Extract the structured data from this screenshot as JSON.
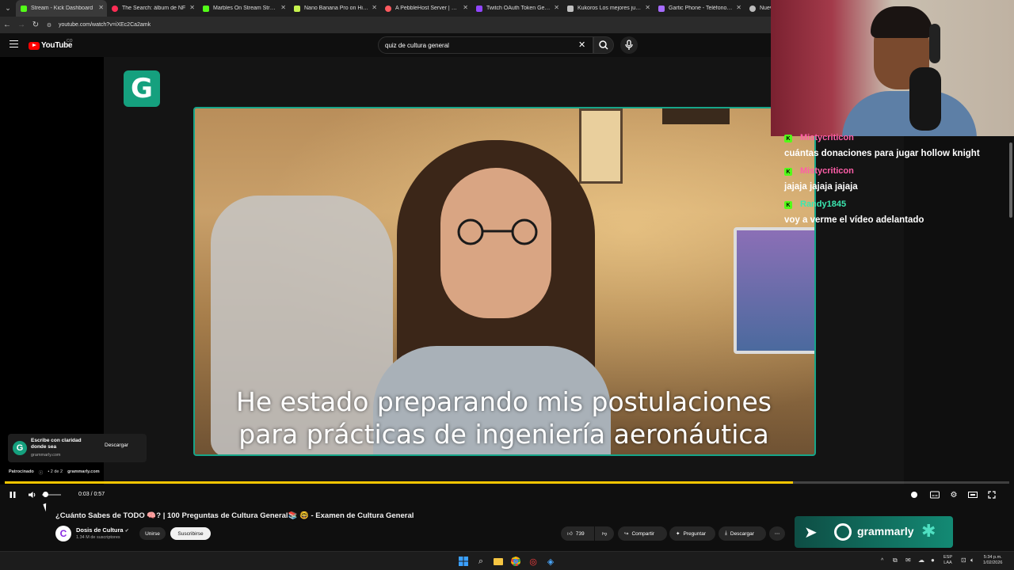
{
  "browser": {
    "tabs": [
      {
        "label": "Stream - Kick Dashboard",
        "color": "#53fc18"
      },
      {
        "label": "The Search: álbum de NF",
        "color": "#ff2d55"
      },
      {
        "label": "Marbles On Stream Streaming",
        "color": "#53fc18"
      },
      {
        "label": "Nano Banana Pro on Higgsfield",
        "color": "#c6f24e"
      },
      {
        "label": "A PebbleHost Server | Console",
        "color": "#ff5a5f"
      },
      {
        "label": "Twitch OAuth Token Generator",
        "color": "#9146ff"
      },
      {
        "label": "Kukoros Los mejores juegos in",
        "color": "#c0c0c0"
      },
      {
        "label": "Gartic Phone - Teléfono Desc",
        "color": "#a66bff"
      },
      {
        "label": "Nueva",
        "color": "#bbbbbb"
      }
    ],
    "url": "youtube.com/watch?v=iXEc2Ca2amk"
  },
  "youtube": {
    "logo": "YouTube",
    "country": "CO",
    "search_value": "quiz de cultura general"
  },
  "player": {
    "caption_line1": "He estado preparando mis postulaciones",
    "caption_line2": "para prácticas de ingeniería aeronáutica",
    "time": "0:03 / 0:57",
    "progress": 0.785,
    "ad": {
      "title": "Escribe con claridad donde sea",
      "domain": "grammarly.com",
      "cta": "Descargar",
      "sponsored": "Patrocinado",
      "count": "• 2 de 2",
      "sponsor_domain": "grammarly.com"
    },
    "accent": "#f7c600"
  },
  "video": {
    "title": "¿Cuánto Sabes de TODO 🧠? | 100 Preguntas de Cultura General📚 🤓 - Examen de Cultura General",
    "channel": "Dosis de Cultura",
    "subscribers": "1.34 M de suscriptores",
    "join": "Unirse",
    "subscribe": "Suscribirse",
    "likes": "739",
    "share": "Compartir",
    "ask": "Preguntar",
    "download": "Descargar"
  },
  "promo": {
    "brand": "grammarly"
  },
  "chat": [
    {
      "user": "Mistycriticon",
      "user_color": "#ff5ea8",
      "text": "cuántas donaciones para jugar hollow knight"
    },
    {
      "user": "Mistycriticon",
      "user_color": "#ff5ea8",
      "text": "jajaja jajaja jajaja"
    },
    {
      "user": "Randy1845",
      "user_color": "#3be8b0",
      "text": "voy a verme el vídeo adelantado"
    }
  ],
  "taskbar": {
    "lang": "ESP",
    "layout": "LAA",
    "time": "5:34 p.m.",
    "date": "1/02/2026"
  }
}
